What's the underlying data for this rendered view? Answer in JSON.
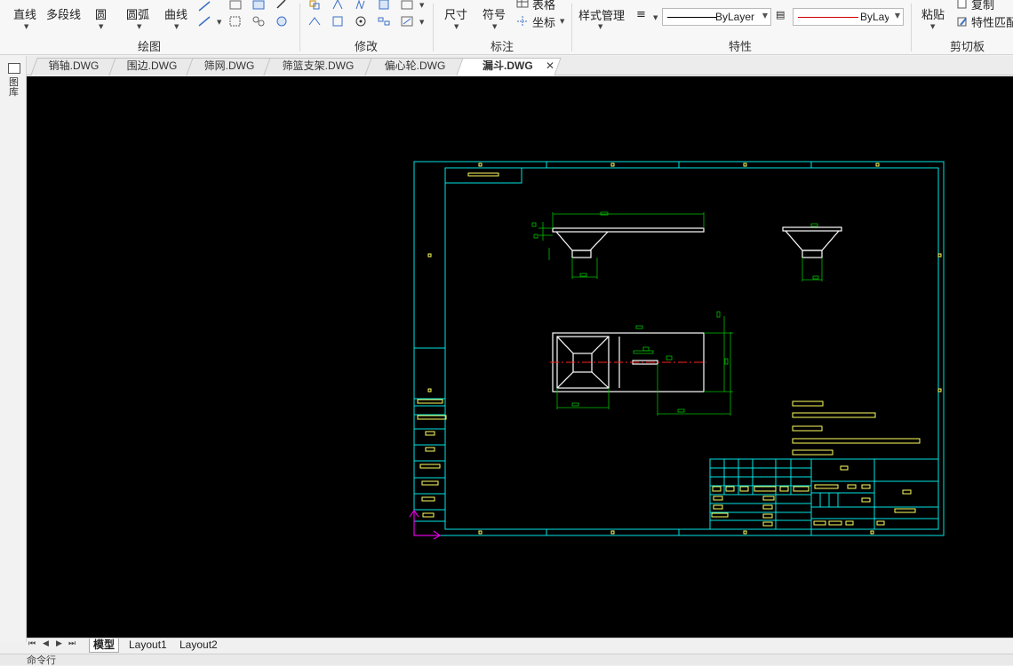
{
  "ribbon": {
    "draw": {
      "line": "直线",
      "polyline": "多段线",
      "circle": "圆",
      "arc": "圆弧",
      "curve": "曲线",
      "group_label": "绘图"
    },
    "modify": {
      "group_label": "修改"
    },
    "annotate": {
      "dimension": "尺寸",
      "symbol": "符号",
      "table": "表格",
      "coordinate": "坐标",
      "group_label": "标注"
    },
    "properties": {
      "style_manager": "样式管理",
      "linetype_value": "ByLayer",
      "color_value": "ByLayer",
      "group_label": "特性"
    },
    "clipboard": {
      "paste": "粘贴",
      "copy": "复制",
      "match_properties": "特性匹配",
      "group_label": "剪切板"
    }
  },
  "left_palette": {
    "label": "图库"
  },
  "tabs": [
    {
      "label": "销轴.DWG",
      "active": false
    },
    {
      "label": "围边.DWG",
      "active": false
    },
    {
      "label": "筛网.DWG",
      "active": false
    },
    {
      "label": "筛篮支架.DWG",
      "active": false
    },
    {
      "label": "偏心轮.DWG",
      "active": false
    },
    {
      "label": "漏斗.DWG",
      "active": true
    }
  ],
  "layout_tabs": [
    {
      "label": "模型",
      "active": true
    },
    {
      "label": "Layout1",
      "active": false
    },
    {
      "label": "Layout2",
      "active": false
    }
  ],
  "command_line": {
    "label": "命令行"
  },
  "colors": {
    "frame": "#00e5e5",
    "part": "#ffffff",
    "dimension": "#00c000",
    "text": "#ffff60",
    "center_line": "#ff2020",
    "ucs": "#e000e0",
    "canvas_bg": "#000000",
    "ribbon_bg": "#f7f7f7"
  }
}
